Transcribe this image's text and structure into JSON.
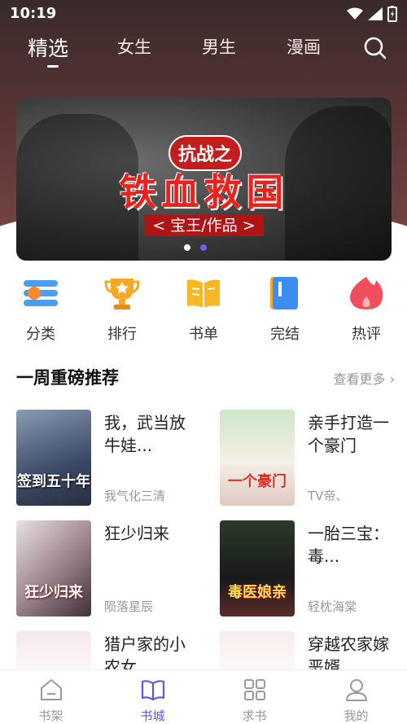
{
  "status": {
    "time": "10:19"
  },
  "nav": {
    "tabs": [
      {
        "label": "精选",
        "active": true
      },
      {
        "label": "女生"
      },
      {
        "label": "男生"
      },
      {
        "label": "漫画"
      }
    ]
  },
  "banner": {
    "tag": "抗战之",
    "title": "铁血救国",
    "subtitle": "< 宝王/作品 >",
    "slide_count": 2,
    "active_slide": 2
  },
  "quick_links": [
    {
      "label": "分类",
      "icon": "category-icon"
    },
    {
      "label": "排行",
      "icon": "trophy-icon"
    },
    {
      "label": "书单",
      "icon": "book-open-icon"
    },
    {
      "label": "完结",
      "icon": "bookmark-book-icon"
    },
    {
      "label": "热评",
      "icon": "flame-icon"
    }
  ],
  "section": {
    "title": "一周重磅推荐",
    "more": "查看更多"
  },
  "books": [
    {
      "title": "我，武当放牛娃...",
      "author": "我气化三清",
      "cover_text": "签到五十年"
    },
    {
      "title": "亲手打造一个豪门",
      "author": "TV帝、",
      "cover_text": "一个豪门"
    },
    {
      "title": "狂少归来",
      "author": "陨落星辰",
      "cover_text": "狂少归来"
    },
    {
      "title": "一胎三宝：毒...",
      "author": "轻枕海棠",
      "cover_text": "毒医娘亲"
    },
    {
      "title": "猎户家的小农女",
      "author": "",
      "cover_text": ""
    },
    {
      "title": "穿越农家嫁恶婿",
      "author": "",
      "cover_text": ""
    }
  ],
  "bottom_nav": [
    {
      "label": "书架"
    },
    {
      "label": "书城",
      "active": true
    },
    {
      "label": "求书"
    },
    {
      "label": "我的"
    }
  ],
  "colors": {
    "accent": "#6a4ff0",
    "banner_red": "#e8221c"
  }
}
